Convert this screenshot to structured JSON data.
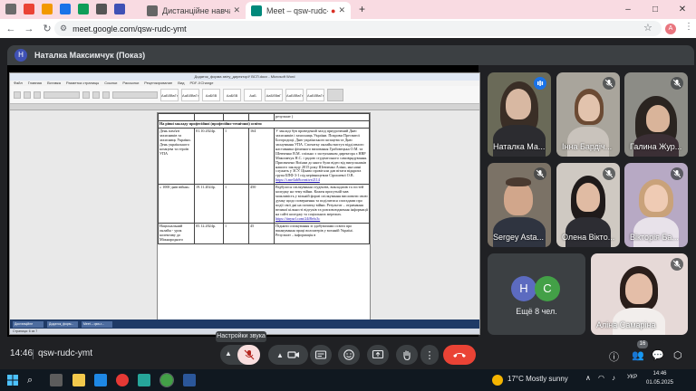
{
  "browser": {
    "tabs": [
      {
        "label": "Дистанційне навчання в ВСП",
        "active": false
      },
      {
        "label": "Meet – qsw-rudc-ymt",
        "active": true
      }
    ],
    "new_tab": "+",
    "url": "meet.google.com/qsw-rudc-ymt",
    "profile_initial": "A",
    "window_controls": [
      "–",
      "□",
      "✕"
    ]
  },
  "meet": {
    "presenter_initial": "Н",
    "presenter_label": "Наталка Максимчук (Показ)",
    "participants": [
      {
        "name": "Наталка Ма...",
        "muted": false,
        "speaking": true
      },
      {
        "name": "Інна Бардіч...",
        "muted": true
      },
      {
        "name": "Галина Жур...",
        "muted": true
      },
      {
        "name": "Sergey Asta...",
        "muted": true
      },
      {
        "name": "Олена Вікто...",
        "muted": true
      },
      {
        "name": "Вікторія Ба...",
        "muted": true
      },
      {
        "name": "Аліна Самаріна",
        "muted": true
      }
    ],
    "more": {
      "avatars": [
        "Н",
        "С"
      ],
      "label": "Ещё 8 чел."
    },
    "tooltip": "Настройки звука",
    "clock": "14:46",
    "code": "qsw-rudc-ymt",
    "people_count": "16"
  },
  "document": {
    "title": "Додаток_форма звіту_директорУ ВСП.docx - Microsoft Word",
    "menu": [
      "Файл",
      "Главная",
      "Вставка",
      "Разметка страницы",
      "Ссылки",
      "Рассылки",
      "Рецензирование",
      "Вид",
      "PDF-XChange"
    ],
    "styles": [
      "АаБбВвГг",
      "АаБбВвГг",
      "АаБбВ",
      "АаБбВ",
      "АаБ",
      "АаБбВвГ",
      "АаБбВвГг",
      "АаБбВвГг"
    ],
    "header_fragment": "результат )",
    "section_heading": "На рівні закладу професійної (професійно-технічної) освіти",
    "rows": [
      {
        "name": "День пам'яті захисників та захисниць України. День українського козацтва та героїв УПА",
        "date": "01.10.2024р.",
        "count": "1",
        "people": "164",
        "description": "У закладі був проведений захід приурочений Дню захисників і захисниць України. Покрови Пресвятої Богородиці, Дню українського козацтва та Дню заснування УПА. Спочатку онлайн виступ відділеного наставника фізичного виховання Грабовецька О.М. та Шевченко В.М. спільно з заступником директора з НВР Максимчук Н.С. і радою студентського самоврядування. Присвячено Воїнам до якого були відео від випускників нашого закладу 2015 року Шевченко Аліни, яка нині служить у ЗСУ. Цікаво провітали дав вітати відкрита група БПФ 3-1 під керівництвом Сірошевої О.В.",
        "link": "https://t.me/lab8creative2114"
      },
      {
        "name": "« 1000 днів війни»",
        "date": "19.11.2024р.",
        "count": "1",
        "people": "450",
        "description": "Відбулося спілкування студентів, викладачів та гостей коледжу на тему війни. Кожен присутній мав можливість у вільній формі спілкування висловити свою думку щодо повернення та поділитися спогадами про події свої дні на початку війни. Результат – отримання великої кількості відгуків та розповсюдження інформації на сайті коледжу та соціальних мережах.",
        "link": "https://tinyurl.com/24f8efx3c"
      },
      {
        "name": "Національний онлайн - урок колективу до Міжнародного",
        "date": "05.12.2024р.",
        "count": "1",
        "people": "45",
        "description": "Підняти спілкування зі здобувачами освіти про вшанування праці волонтерів у воєнній Україні. Результат – інформація в",
        "link": ""
      }
    ],
    "status_left": "Страница: 6 из 7",
    "taskbar_items": [
      "Дистанційне",
      "Додаток_форм...",
      "Meet – qsw-r..."
    ]
  },
  "taskbar": {
    "weather": "17°C  Mostly sunny",
    "lang": "УКР",
    "time": "14:46",
    "date": "01.05.2025"
  }
}
